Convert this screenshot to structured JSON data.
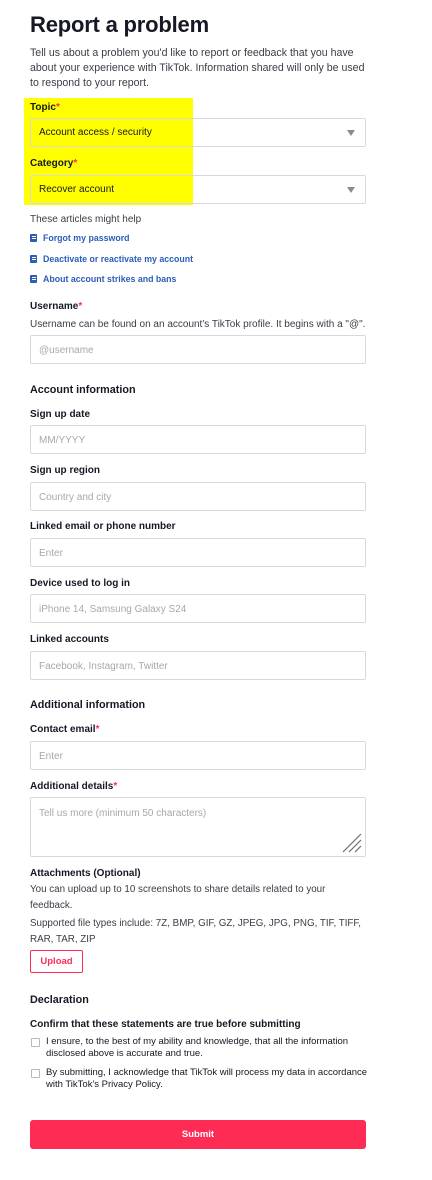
{
  "page_title": "Report a problem",
  "intro": "Tell us about a problem you'd like to report or feedback that you have about your experience with TikTok. Information shared will only be used to respond to your report.",
  "required_mark": "*",
  "topic": {
    "label": "Topic",
    "value": "Account access / security"
  },
  "category": {
    "label": "Category",
    "value": "Recover account"
  },
  "articles": {
    "heading": "These articles might help",
    "items": [
      "Forgot my password",
      "Deactivate or reactivate my account",
      "About account strikes and bans"
    ]
  },
  "username": {
    "label": "Username",
    "help": "Username can be found on an account's TikTok profile. It begins with a \"@\".",
    "placeholder": "@username"
  },
  "account_info": {
    "heading": "Account information",
    "signup_date": {
      "label": "Sign up date",
      "placeholder": "MM/YYYY"
    },
    "signup_region": {
      "label": "Sign up region",
      "placeholder": "Country and city"
    },
    "linked_email": {
      "label": "Linked email or phone number",
      "placeholder": "Enter"
    },
    "device": {
      "label": "Device used to log in",
      "placeholder": "iPhone 14, Samsung Galaxy S24"
    },
    "linked_accounts": {
      "label": "Linked accounts",
      "placeholder": "Facebook, Instagram, Twitter"
    }
  },
  "additional_info": {
    "heading": "Additional information",
    "contact_email": {
      "label": "Contact email",
      "placeholder": "Enter"
    },
    "details": {
      "label": "Additional details",
      "placeholder": "Tell us more (minimum 50 characters)"
    }
  },
  "attachments": {
    "label": "Attachments (Optional)",
    "help": "You can upload up to 10 screenshots to share details related to your feedback.",
    "types": "Supported file types include: 7Z, BMP, GIF, GZ, JPEG, JPG, PNG, TIF, TIFF, RAR, TAR, ZIP",
    "upload_label": "Upload"
  },
  "declaration": {
    "heading": "Declaration",
    "confirm": "Confirm that these statements are true before submitting",
    "statement1": "I ensure, to the best of my ability and knowledge, that all the information disclosed above is accurate and true.",
    "statement2": "By submitting, I acknowledge that TikTok will process my data in accordance with TikTok's Privacy Policy."
  },
  "submit_label": "Submit",
  "colors": {
    "accent": "#fe2c55",
    "link": "#2b5db8",
    "highlight": "#ffff00",
    "border": "#d9d9dc"
  },
  "icons": {
    "select_caret": "caret-down-icon",
    "article": "document-icon",
    "resize": "resize-grip-icon"
  }
}
